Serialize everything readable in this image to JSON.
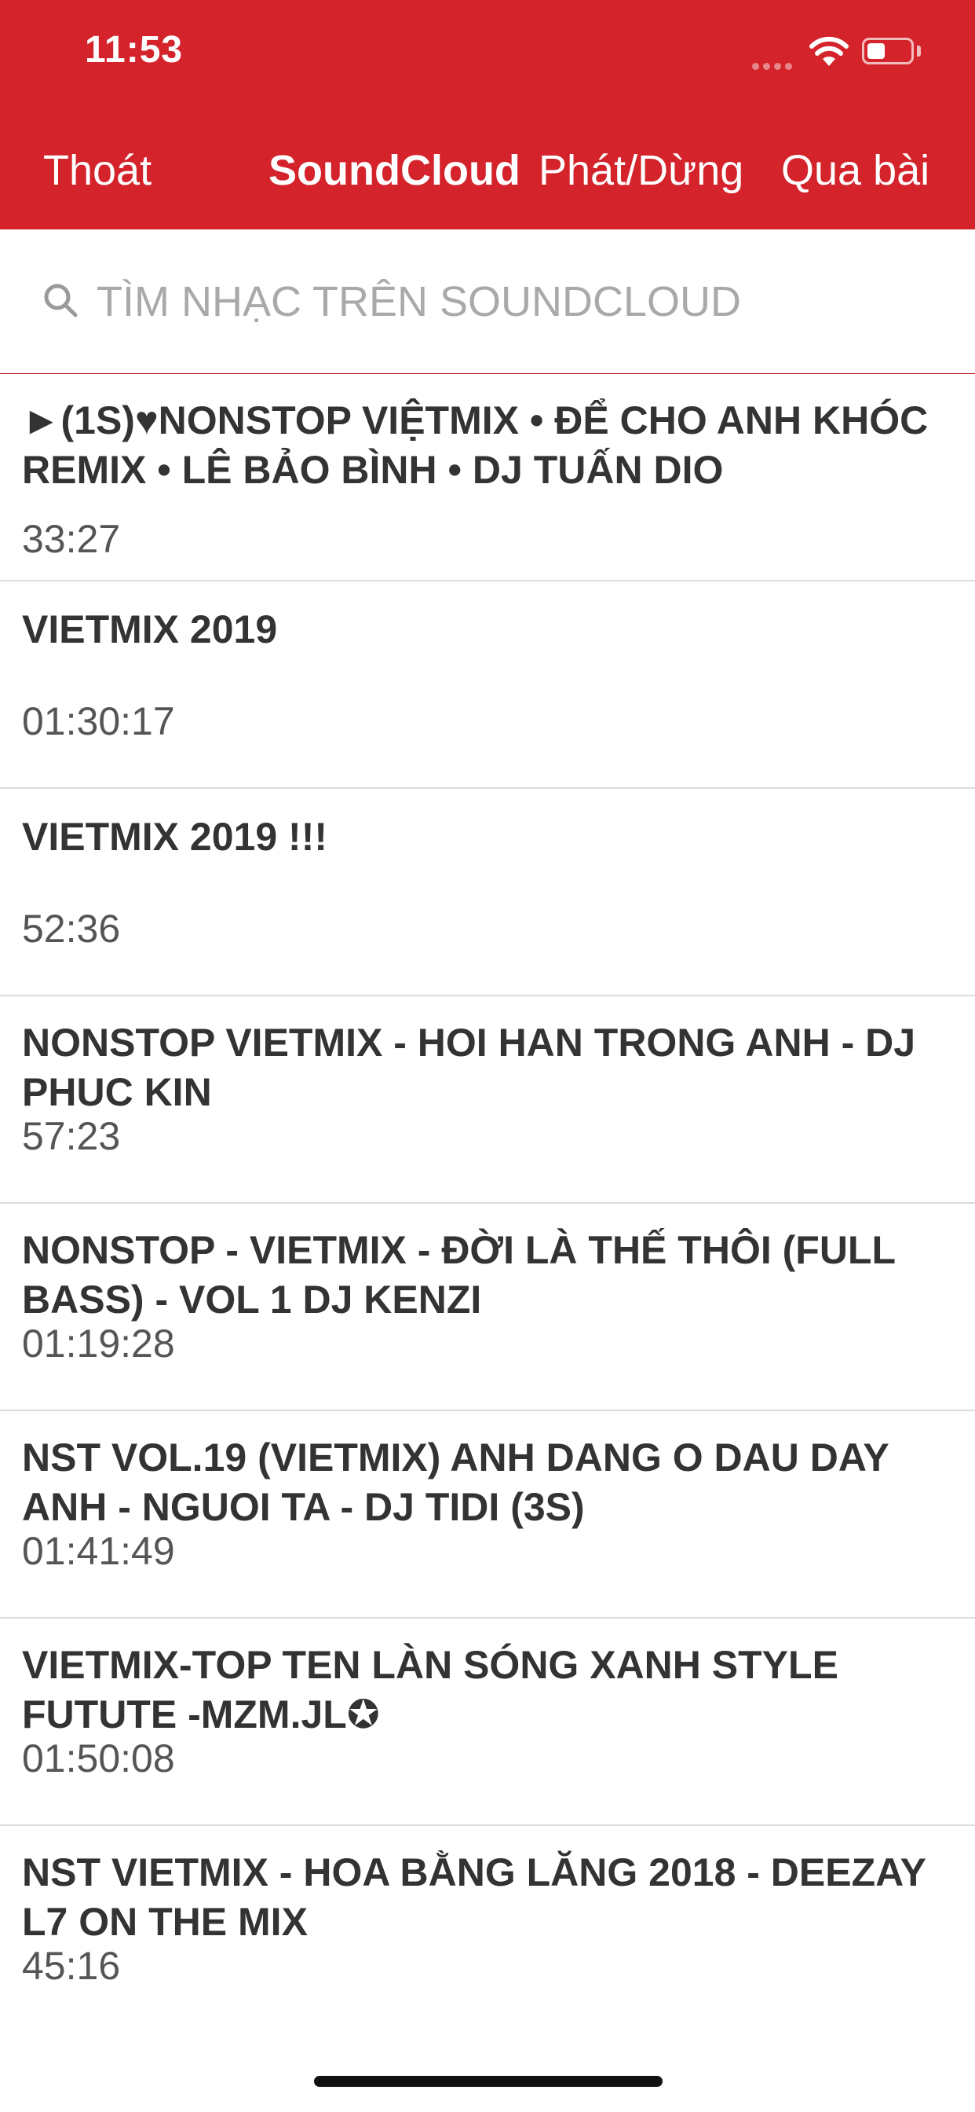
{
  "status_bar": {
    "time": "11:53"
  },
  "nav": {
    "exit_label": "Thoát",
    "title": "SoundCloud",
    "play_pause_label": "Phát/Dừng",
    "next_label": "Qua bài"
  },
  "search": {
    "placeholder": "TÌM NHẠC TRÊN SOUNDCLOUD",
    "value": ""
  },
  "tracks": [
    {
      "title": "►(1S)♥NONSTOP VIỆTMIX • ĐỂ CHO ANH KHÓC REMIX • LÊ BẢO BÌNH • DJ TUẤN DIO",
      "duration": "33:27"
    },
    {
      "title": "VIETMIX 2019",
      "duration": "01:30:17"
    },
    {
      "title": "VIETMIX 2019 !!!",
      "duration": "52:36"
    },
    {
      "title": "NONSTOP VIETMIX - HOI HAN TRONG ANH - DJ PHUC KIN",
      "duration": "57:23"
    },
    {
      "title": "NONSTOP - VIETMIX - ĐỜI LÀ THẾ THÔI (FULL BASS) -  VOL 1 DJ KENZI",
      "duration": "01:19:28"
    },
    {
      "title": "NST VOL.19 (VIETMIX) ANH DANG O DAU DAY ANH - NGUOI TA - DJ TIDI (3S)",
      "duration": "01:41:49"
    },
    {
      "title": "VIETMIX-TOP TEN LÀN SÓNG XANH STYLE FUTUTE -MZM.JL✪",
      "duration": "01:50:08"
    },
    {
      "title": "NST VIETMIX - HOA BẰNG LĂNG 2018 - DEEZAY L7 ON THE MIX",
      "duration": "45:16"
    }
  ],
  "colors": {
    "header_bg": "#d4232b",
    "text": "#333333",
    "separator": "#dcdcdc"
  },
  "icons": {
    "search": "search-icon",
    "wifi": "wifi-icon",
    "battery": "battery-icon",
    "signal": "signal-icon"
  }
}
